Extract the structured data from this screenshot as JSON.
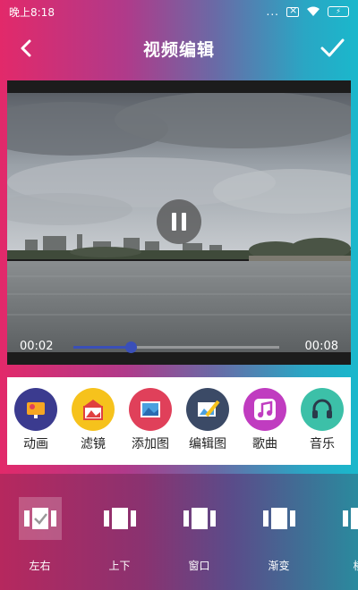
{
  "status_bar": {
    "time": "晚上8:18",
    "dots": "..."
  },
  "header": {
    "title": "视频编辑",
    "back_icon": "back-arrow-icon",
    "confirm_icon": "checkmark-icon"
  },
  "player": {
    "current_time": "00:02",
    "total_time": "00:08",
    "progress": 0.28,
    "state_icon": "pause-icon"
  },
  "tools": [
    {
      "label": "动画",
      "icon": "animation-icon",
      "color": "#3b3b8f"
    },
    {
      "label": "滤镜",
      "icon": "filter-icon",
      "color": "#f6c21c"
    },
    {
      "label": "添加图",
      "icon": "add-image-icon",
      "color": "#e0405a"
    },
    {
      "label": "编辑图",
      "icon": "edit-image-icon",
      "color": "#3b4a66"
    },
    {
      "label": "歌曲",
      "icon": "music-note-icon",
      "color": "#c03cc0"
    },
    {
      "label": "音乐",
      "icon": "headphones-icon",
      "color": "#3cc0a8"
    }
  ],
  "transitions": [
    {
      "label": "左右",
      "selected": true
    },
    {
      "label": "上下",
      "selected": false
    },
    {
      "label": "窗口",
      "selected": false
    },
    {
      "label": "渐变",
      "selected": false
    },
    {
      "label": "横",
      "selected": false
    }
  ]
}
